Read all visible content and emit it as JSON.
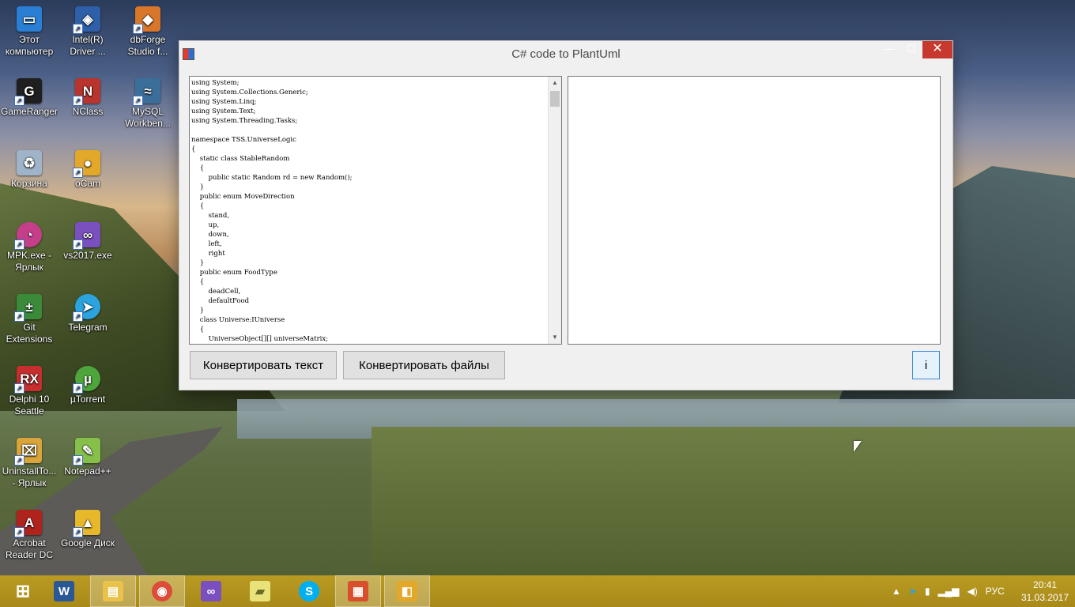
{
  "desktop": {
    "icons": [
      {
        "label": "Этот компьютер",
        "icon": "computer-icon",
        "color": "#2a7fd4"
      },
      {
        "label": "Intel(R) Driver ...",
        "icon": "intel-shield-icon",
        "color": "#2f5fa8"
      },
      {
        "label": "dbForge Studio f...",
        "icon": "dbforge-icon",
        "color": "#d8772a"
      },
      {
        "label": "GameRanger",
        "icon": "gameranger-icon",
        "color": "#1f1f1f"
      },
      {
        "label": "NClass",
        "icon": "nclass-icon",
        "color": "#b8342c"
      },
      {
        "label": "MySQL Workben...",
        "icon": "mysql-dolphin-icon",
        "color": "#3b6f9a"
      },
      {
        "label": "Корзина",
        "icon": "recycle-bin-icon",
        "color": "#9fb4c8"
      },
      {
        "label": "oCam",
        "icon": "ocam-icon",
        "color": "#e3a82a"
      },
      {
        "label": "MPK.exe - Ярлык",
        "icon": "mpk-icon",
        "color": "#c43e8a"
      },
      {
        "label": "vs2017.exe",
        "icon": "visual-studio-icon",
        "color": "#7a4fbf"
      },
      {
        "label": "Git Extensions",
        "icon": "git-extensions-icon",
        "color": "#3b8a3a"
      },
      {
        "label": "Telegram",
        "icon": "telegram-icon",
        "color": "#2aa3df"
      },
      {
        "label": "Delphi 10 Seattle",
        "icon": "delphi-icon",
        "color": "#c72e2e"
      },
      {
        "label": "µTorrent",
        "icon": "utorrent-icon",
        "color": "#4da53c"
      },
      {
        "label": "UninstallTo... - Ярлык",
        "icon": "uninstall-tool-icon",
        "color": "#d9a53a"
      },
      {
        "label": "Notepad++",
        "icon": "notepad-plus-plus-icon",
        "color": "#86c04a"
      },
      {
        "label": "Acrobat Reader DC",
        "icon": "acrobat-icon",
        "color": "#b0231c"
      },
      {
        "label": "Google Диск",
        "icon": "google-drive-icon",
        "color": "#e6b82a"
      }
    ]
  },
  "window": {
    "title": "C# code to PlantUml",
    "code_text": "using System;\nusing System.Collections.Generic;\nusing System.Linq;\nusing System.Text;\nusing System.Threading.Tasks;\n\nnamespace TSS.UniverseLogic\n{\n    static class StableRandom\n    {\n        public static Random rd = new Random();\n    }\n    public enum MoveDirection\n    {\n        stand,\n        up,\n        down,\n        left,\n        right\n    }\n    public enum FoodType\n    {\n        deadCell,\n        defaultFood\n    }\n    class Universe:IUniverse\n    {\n        UniverseObject[][] universeMatrix;",
    "output_text": "",
    "buttons": {
      "convert_text": "Конвертировать текст",
      "convert_files": "Конвертировать файлы",
      "info": "i"
    },
    "controls": {
      "minimize": "—",
      "maximize": "☐",
      "close": "✕"
    }
  },
  "taskbar": {
    "apps": [
      {
        "icon": "windows-start-icon",
        "color": "#ffffff",
        "glyph": "⊞"
      },
      {
        "icon": "word-icon",
        "color": "#2b5797",
        "glyph": "W"
      },
      {
        "icon": "file-explorer-icon",
        "color": "#e8c24a",
        "glyph": "▤"
      },
      {
        "icon": "chrome-icon",
        "color": "#dd4b39",
        "glyph": "◉"
      },
      {
        "icon": "visual-studio-icon",
        "color": "#7a4fbf",
        "glyph": "∞"
      },
      {
        "icon": "sticky-notes-icon",
        "color": "#e9e27a",
        "glyph": "▰"
      },
      {
        "icon": "skype-icon",
        "color": "#00aff0",
        "glyph": "S"
      },
      {
        "icon": "plantuml-app-icon",
        "color": "#d94f2b",
        "glyph": "▦"
      },
      {
        "icon": "ocam-taskbar-icon",
        "color": "#e3a82a",
        "glyph": "◧"
      }
    ],
    "tray": {
      "language": "РУС"
    },
    "clock": {
      "time": "20:41",
      "date": "31.03.2017"
    }
  }
}
